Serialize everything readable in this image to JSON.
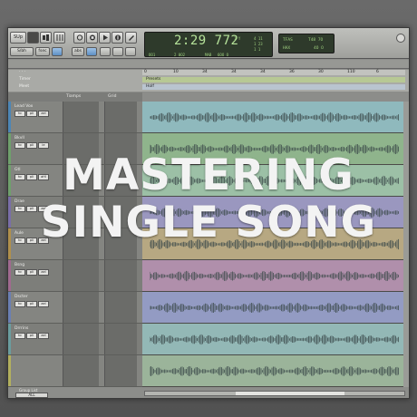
{
  "toolbar": {
    "mode_label": "SUp",
    "labels_row": [
      "S/bh",
      "fsec",
      "abs"
    ],
    "transport_icons": [
      "loop-icon",
      "stop-icon",
      "play-icon",
      "record-icon",
      "pencil-icon"
    ]
  },
  "counter": {
    "main": "2:29 772",
    "left_small": "OO1",
    "mid_small": "2 0O2",
    "bar_label": "MAB",
    "bar_value": "6OO O",
    "side_a": "1 Y",
    "side_b": "4 11",
    "side_c": "1 23",
    "side_d": "1 1"
  },
  "meter": {
    "top_label": "TFAS",
    "top_value": "T48 7O",
    "bottom_label": "HAX",
    "bottom_value": "4O O"
  },
  "rulers": {
    "timer_label": "Timer",
    "meet_label": "Meet",
    "tempo_marker": "Presets",
    "meter_marker": "Holf",
    "ticks": [
      "0",
      "10",
      "34",
      "34",
      "34",
      "36",
      "30",
      "110",
      "6"
    ]
  },
  "column_headers": [
    "Tiamps",
    "Grid"
  ],
  "tracks": [
    {
      "name": "Lead Vox",
      "color": "#4d86b6",
      "lane_color": "#8fb9bd",
      "btns": [
        "hc",
        "pli",
        "ael"
      ]
    },
    {
      "name": "Bkvll",
      "color": "#6fa06c",
      "lane_color": "#8fb48c",
      "btns": [
        "hc",
        "pli",
        "ie"
      ]
    },
    {
      "name": "Gtl",
      "color": "#6fa06c",
      "lane_color": "#9cc0a6",
      "btns": [
        "hc",
        "pli",
        "aHl"
      ]
    },
    {
      "name": "Drae",
      "color": "#7a6ea8",
      "lane_color": "#9a97bf",
      "btns": [
        "hc",
        "pli",
        "ael"
      ]
    },
    {
      "name": "Aule",
      "color": "#b0904c",
      "lane_color": "#b7a882",
      "btns": [
        "hc",
        "pli",
        "ael"
      ]
    },
    {
      "name": "Bsng",
      "color": "#a06a8f",
      "lane_color": "#b08fab",
      "btns": [
        "hc",
        "pli",
        "ael"
      ]
    },
    {
      "name": "Dscter",
      "color": "#6b7fb3",
      "lane_color": "#939bc3",
      "btns": [
        "hc",
        "pli",
        "ael"
      ]
    },
    {
      "name": "Drrrins",
      "color": "#6a9d9f",
      "lane_color": "#93b8b6",
      "btns": [
        "hc",
        "pli",
        "ael"
      ]
    },
    {
      "name": "",
      "color": "#b3b05e",
      "lane_color": "#9bb49a",
      "btns": []
    }
  ],
  "groups": {
    "label": "Group List",
    "all": "ALL"
  },
  "overlay": {
    "line1": "MASTERING",
    "line2": "SINGLE SONG"
  }
}
